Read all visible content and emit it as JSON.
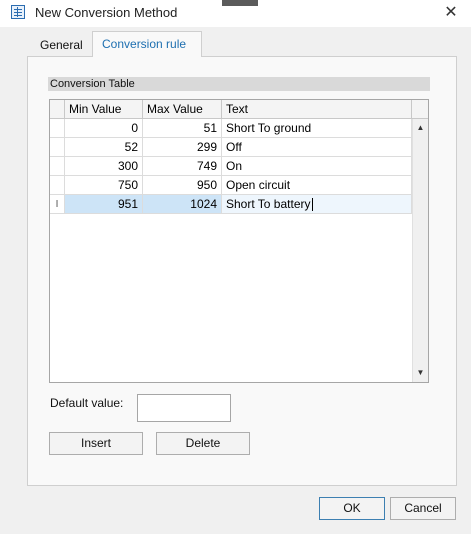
{
  "window": {
    "title": "New Conversion Method",
    "close_glyph": "✕",
    "icon": "table-icon"
  },
  "tabs": [
    {
      "label": "General",
      "active": false
    },
    {
      "label": "Conversion rule",
      "active": true
    }
  ],
  "conversion_table": {
    "group_label": "Conversion Table",
    "columns": [
      "Min Value",
      "Max Value",
      "Text"
    ],
    "rows": [
      {
        "min": "0",
        "max": "51",
        "text": "Short To ground",
        "marker": ""
      },
      {
        "min": "52",
        "max": "299",
        "text": "Off",
        "marker": ""
      },
      {
        "min": "300",
        "max": "749",
        "text": "On",
        "marker": ""
      },
      {
        "min": "750",
        "max": "950",
        "text": "Open circuit",
        "marker": ""
      },
      {
        "min": "951",
        "max": "1024",
        "text": "Short To battery",
        "marker": "I",
        "selected": true
      }
    ],
    "scroll_up": "▲",
    "scroll_down": "▼"
  },
  "default_value": {
    "label": "Default value:",
    "value": ""
  },
  "buttons": {
    "insert": "Insert",
    "delete": "Delete",
    "ok": "OK",
    "cancel": "Cancel"
  },
  "colors": {
    "accent": "#1e6fb0",
    "selection": "#cde4f7"
  }
}
